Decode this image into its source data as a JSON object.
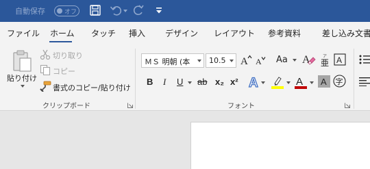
{
  "titlebar": {
    "autosave_label": "自動保存",
    "toggle_state": "オフ",
    "colors": {
      "background": "#2b579a",
      "muted": "#8fa7cd"
    }
  },
  "tabs": [
    {
      "label": "ファイル",
      "active": false
    },
    {
      "label": "ホーム",
      "active": true
    },
    {
      "label": "タッチ",
      "active": false
    },
    {
      "label": "挿入",
      "active": false
    },
    {
      "label": "デザイン",
      "active": false
    },
    {
      "label": "レイアウト",
      "active": false
    },
    {
      "label": "参考資料",
      "active": false
    },
    {
      "label": "差し込み文書",
      "active": false
    }
  ],
  "clipboard": {
    "paste_label": "貼り付け",
    "cut_label": "切り取り",
    "copy_label": "コピー",
    "format_painter_label": "書式のコピー/貼り付け",
    "group_label": "クリップボード"
  },
  "font": {
    "font_name": "ＭＳ 明朝 (本",
    "font_size": "10.5",
    "change_case_label": "Aa",
    "group_label": "フォント",
    "buttons": {
      "bold": "B",
      "italic": "I",
      "underline": "U",
      "strikethrough": "ab",
      "subscript": "x₂",
      "superscript": "x²"
    },
    "colors": {
      "highlight": "#ffff00",
      "font_color": "#c00000",
      "text_effect": "#4472c4"
    }
  }
}
